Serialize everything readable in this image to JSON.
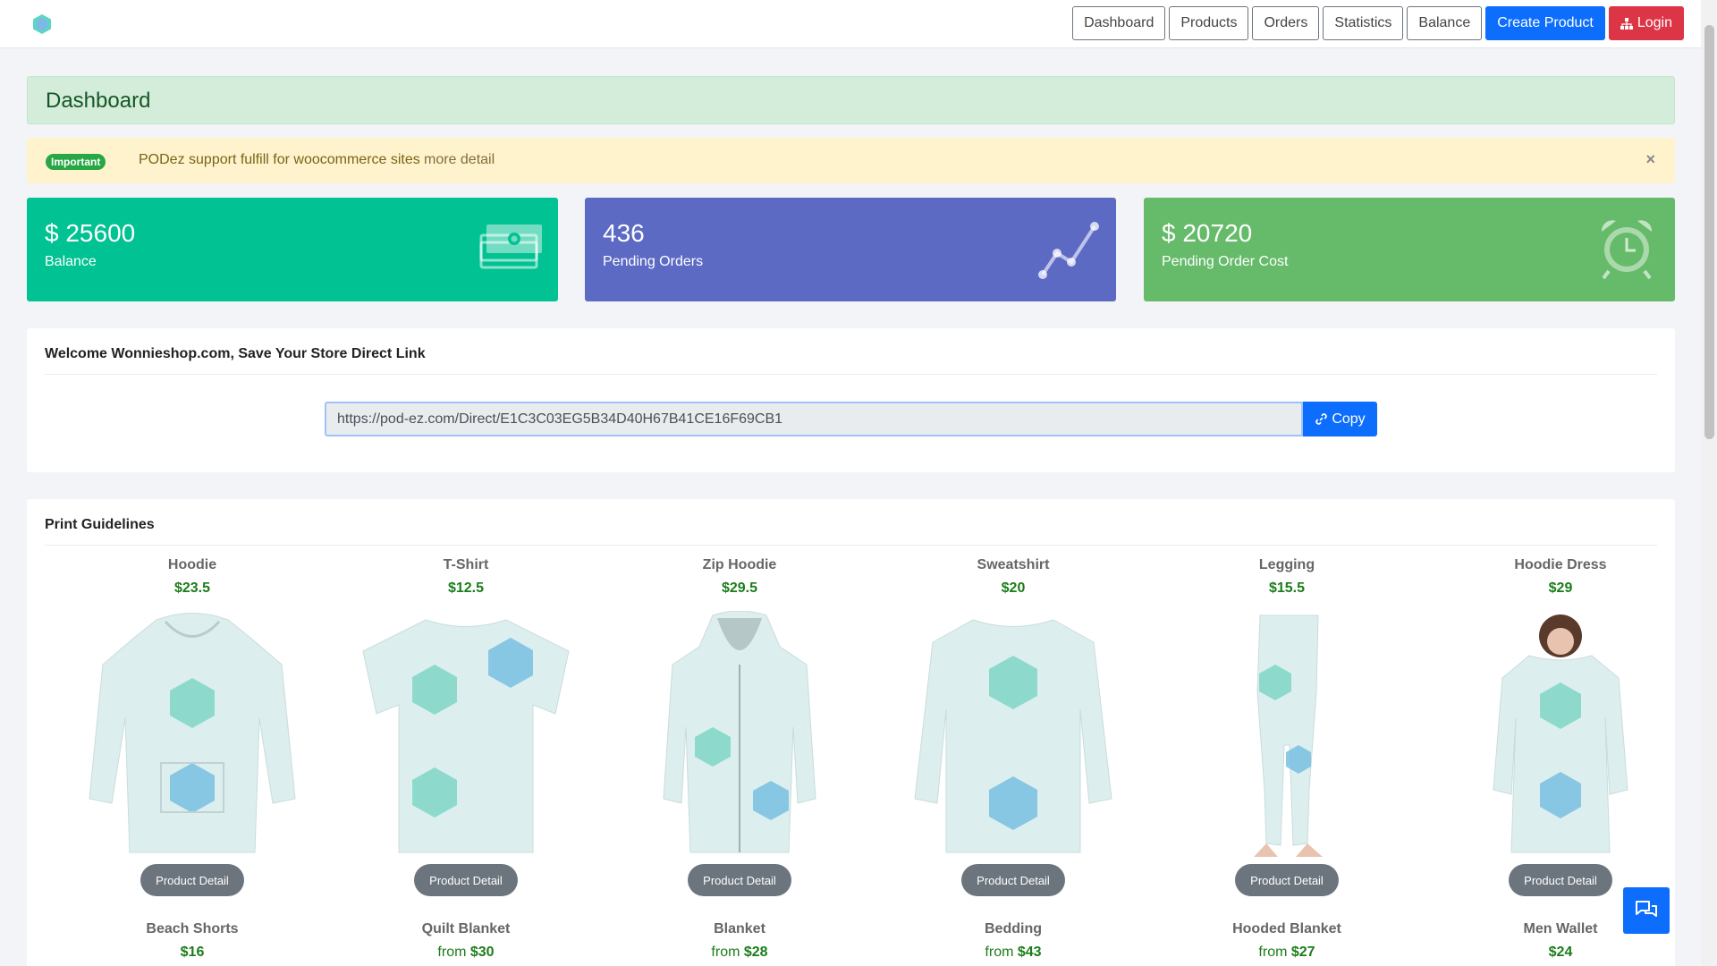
{
  "nav": {
    "logo_icon": "podez-logo-icon",
    "buttons": {
      "dashboard": "Dashboard",
      "products": "Products",
      "orders": "Orders",
      "statistics": "Statistics",
      "balance": "Balance",
      "create_product": "Create Product",
      "login": "Login"
    }
  },
  "header": {
    "title": "Dashboard"
  },
  "alert": {
    "badge": "Important",
    "text": "PODez support fulfill for woocommerce sites",
    "link": "more detail",
    "close": "×"
  },
  "stats": {
    "balance": {
      "value": "$ 25600",
      "label": "Balance",
      "icon": "money-icon"
    },
    "orders": {
      "value": "436",
      "label": "Pending Orders",
      "icon": "line-chart-icon"
    },
    "cost": {
      "value": "$ 20720",
      "label": "Pending Order Cost",
      "icon": "alarm-clock-icon"
    }
  },
  "welcome": {
    "title": "Welcome Wonnieshop.com, Save Your Store Direct Link",
    "link": "https://pod-ez.com/Direct/E1C3C03EG5B34D40H67B41CE16F69CB1",
    "copy_label": "Copy"
  },
  "guidelines": {
    "title": "Print Guidelines",
    "detail_label": "Product Detail",
    "items": [
      {
        "name": "Hoodie",
        "price": "$23.5"
      },
      {
        "name": "T-Shirt",
        "price": "$12.5"
      },
      {
        "name": "Zip Hoodie",
        "price": "$29.5"
      },
      {
        "name": "Sweatshirt",
        "price": "$20"
      },
      {
        "name": "Legging",
        "price": "$15.5"
      },
      {
        "name": "Hoodie Dress",
        "price": "$29"
      }
    ],
    "row2": [
      {
        "name": "Beach Shorts",
        "prefix": "",
        "price": "$16"
      },
      {
        "name": "Quilt Blanket",
        "prefix": "from",
        "price": "$30"
      },
      {
        "name": "Blanket",
        "prefix": "from",
        "price": "$28"
      },
      {
        "name": "Bedding",
        "prefix": "from",
        "price": "$43"
      },
      {
        "name": "Hooded Blanket",
        "prefix": "from",
        "price": "$27"
      },
      {
        "name": "Men Wallet",
        "prefix": "",
        "price": "$24"
      }
    ]
  },
  "chat": {
    "icon": "chat-icon"
  },
  "colors": {
    "primary": "#0d6efd",
    "danger": "#dc3545",
    "balance": "#00c292",
    "orders": "#5c6ac4",
    "cost": "#66bb6a"
  }
}
